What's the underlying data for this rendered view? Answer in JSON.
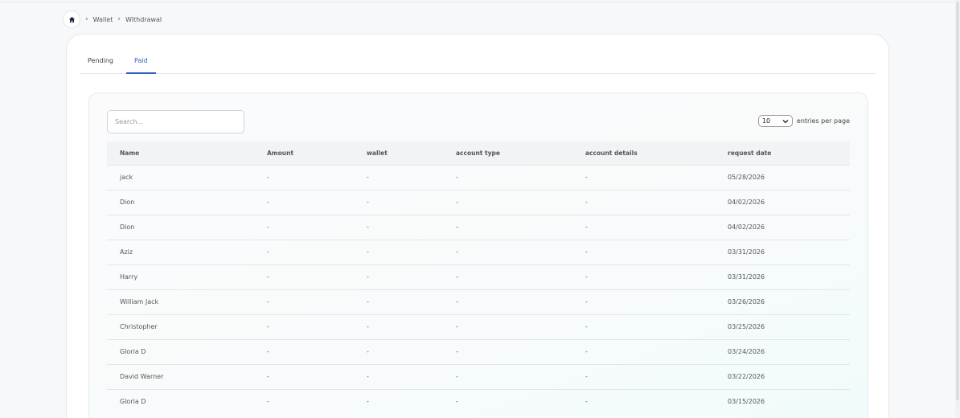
{
  "breadcrumb": {
    "items": [
      "Wallet",
      "Withdrawal"
    ]
  },
  "tabs": [
    {
      "label": "Pending",
      "active": false
    },
    {
      "label": "Paid",
      "active": true
    }
  ],
  "search": {
    "placeholder": "Search..."
  },
  "entries": {
    "value": "10",
    "label": "entries per page"
  },
  "table": {
    "columns": [
      "Name",
      "Amount",
      "wallet",
      "account type",
      "account details",
      "request date"
    ],
    "rows": [
      [
        "jack",
        "-",
        "-",
        "-",
        "-",
        "05/28/2026"
      ],
      [
        "Dion",
        "-",
        "-",
        "-",
        "-",
        "04/02/2026"
      ],
      [
        "Dion",
        "-",
        "-",
        "-",
        "-",
        "04/02/2026"
      ],
      [
        "Aziz",
        "-",
        "-",
        "-",
        "-",
        "03/31/2026"
      ],
      [
        "Harry",
        "-",
        "-",
        "-",
        "-",
        "03/31/2026"
      ],
      [
        "William Jack",
        "-",
        "-",
        "-",
        "-",
        "03/26/2026"
      ],
      [
        "Christopher",
        "-",
        "-",
        "-",
        "-",
        "03/25/2026"
      ],
      [
        "Gloria D",
        "-",
        "-",
        "-",
        "-",
        "03/24/2026"
      ],
      [
        "David Warner",
        "-",
        "-",
        "-",
        "-",
        "03/22/2026"
      ],
      [
        "Gloria D",
        "-",
        "-",
        "-",
        "-",
        "03/15/2026"
      ]
    ]
  },
  "colors": {
    "accent": "#2f5fc4"
  }
}
